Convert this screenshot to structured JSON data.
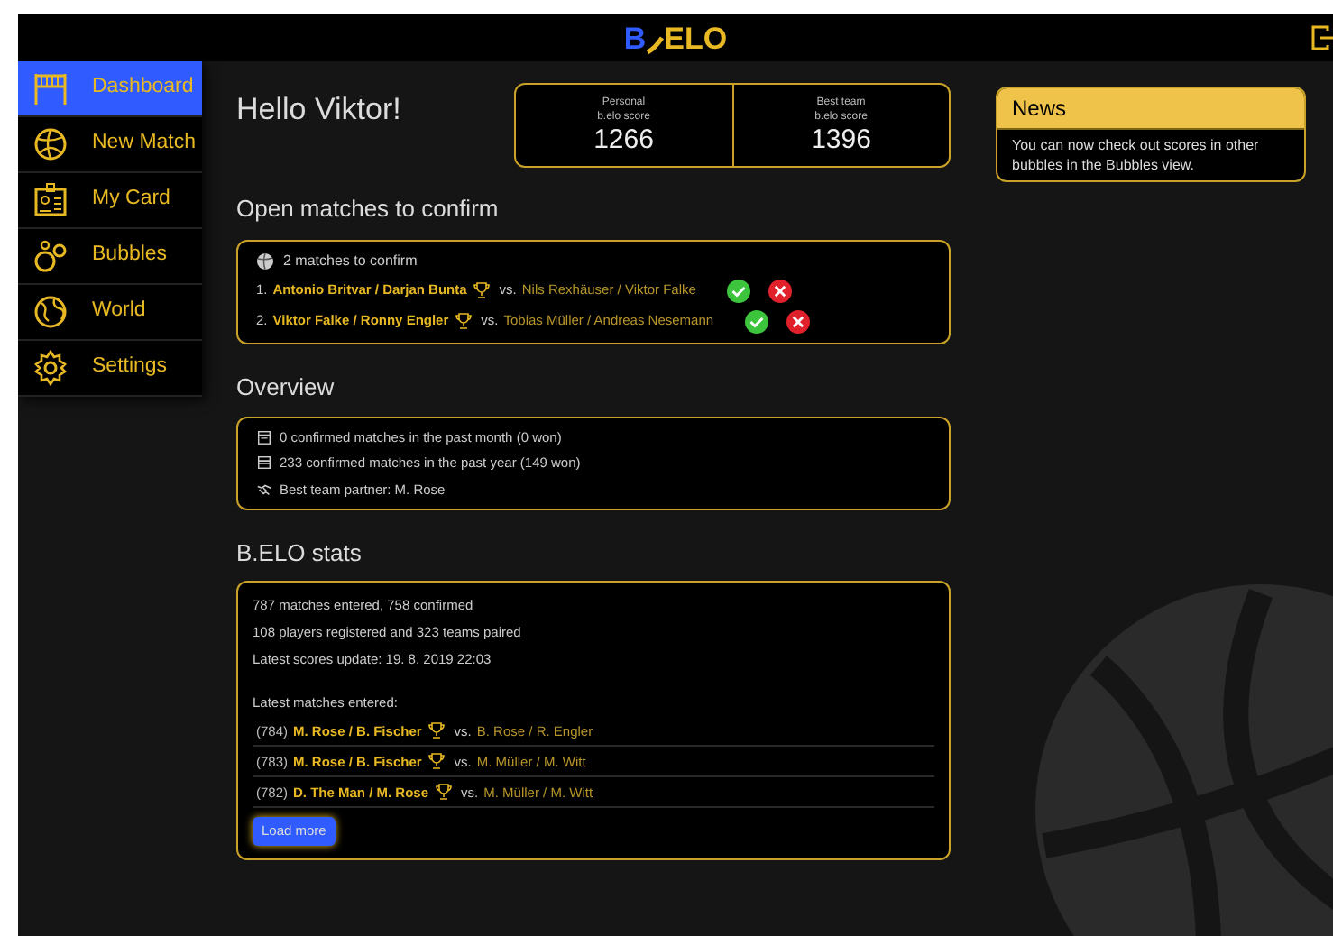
{
  "header": {
    "logo_left": "B",
    "logo_right": "ELO"
  },
  "sidebar": {
    "items": [
      {
        "label": "Dashboard",
        "selected": true
      },
      {
        "label": "New Match",
        "selected": false
      },
      {
        "label": "My Card",
        "selected": false
      },
      {
        "label": "Bubbles",
        "selected": false
      },
      {
        "label": "World",
        "selected": false
      },
      {
        "label": "Settings",
        "selected": false
      }
    ]
  },
  "greeting": "Hello Viktor!",
  "scores": [
    {
      "label_1": "Personal",
      "label_2": "b.elo score",
      "value": "1266"
    },
    {
      "label_1": "Best team",
      "label_2": "b.elo score",
      "value": "1396"
    }
  ],
  "open_matches": {
    "heading": "Open matches to confirm",
    "summary": "2 matches to confirm",
    "rows": [
      {
        "number": "1.",
        "winners": "Antonio Britvar / Darjan Bunta",
        "vs": "vs.",
        "losers": "Nils Rexhäuser / Viktor Falke"
      },
      {
        "number": "2.",
        "winners": "Viktor Falke / Ronny Engler",
        "vs": "vs.",
        "losers": "Tobias Müller / Andreas Nesemann"
      }
    ]
  },
  "overview": {
    "heading": "Overview",
    "lines": [
      {
        "text": "0 confirmed matches in the past month (0 won)"
      },
      {
        "text": "233 confirmed matches in the past year (149 won)"
      },
      {
        "text": "Best team partner: M. Rose"
      }
    ]
  },
  "stats": {
    "heading": "B.ELO stats",
    "lines": [
      "787 matches entered, 758 confirmed",
      "108 players registered and 323 teams paired",
      "Latest scores update: 19. 8. 2019 22:03"
    ],
    "latest_heading": "Latest matches entered:",
    "matches": [
      {
        "id": "(784)",
        "winners": "M. Rose / B. Fischer",
        "vs": "vs.",
        "losers": "B. Rose / R. Engler"
      },
      {
        "id": "(783)",
        "winners": "M. Rose / B. Fischer",
        "vs": "vs.",
        "losers": "M. Müller / M. Witt"
      },
      {
        "id": "(782)",
        "winners": "D. The Man / M. Rose",
        "vs": "vs.",
        "losers": "M. Müller / M. Witt"
      }
    ],
    "load_more": "Load more"
  },
  "news": {
    "title": "News",
    "text": "You can now check out scores in other bubbles in the Bubbles view."
  }
}
